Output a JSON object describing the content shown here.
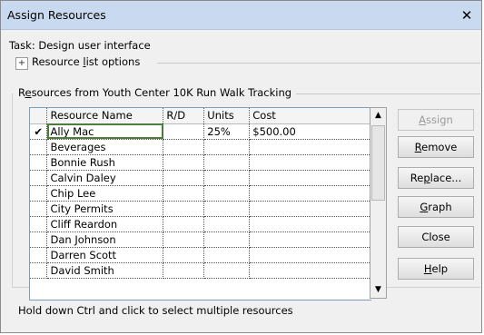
{
  "window": {
    "title": "Assign Resources",
    "close_glyph": "✕"
  },
  "task": {
    "text": "Task: Design user interface"
  },
  "options": {
    "expander_glyph": "+",
    "label_pre": "Resource ",
    "label_key": "l",
    "label_post": "ist options"
  },
  "group": {
    "label_pre": "R",
    "label_key": "e",
    "label_post": "sources from Youth Center 10K Run Walk Tracking"
  },
  "table": {
    "columns": [
      "",
      "Resource Name",
      "R/D",
      "Units",
      "Cost"
    ],
    "rows": [
      {
        "check": "✔",
        "name": "Ally Mac",
        "rd": "",
        "units": "25%",
        "cost": "$500.00"
      },
      {
        "check": "",
        "name": "Beverages",
        "rd": "",
        "units": "",
        "cost": ""
      },
      {
        "check": "",
        "name": "Bonnie Rush",
        "rd": "",
        "units": "",
        "cost": ""
      },
      {
        "check": "",
        "name": "Calvin Daley",
        "rd": "",
        "units": "",
        "cost": ""
      },
      {
        "check": "",
        "name": "Chip Lee",
        "rd": "",
        "units": "",
        "cost": ""
      },
      {
        "check": "",
        "name": "City Permits",
        "rd": "",
        "units": "",
        "cost": ""
      },
      {
        "check": "",
        "name": "Cliff Reardon",
        "rd": "",
        "units": "",
        "cost": ""
      },
      {
        "check": "",
        "name": "Dan Johnson",
        "rd": "",
        "units": "",
        "cost": ""
      },
      {
        "check": "",
        "name": "Darren Scott",
        "rd": "",
        "units": "",
        "cost": ""
      },
      {
        "check": "",
        "name": "David Smith",
        "rd": "",
        "units": "",
        "cost": ""
      }
    ]
  },
  "scrollbar": {
    "up_glyph": "▲",
    "down_glyph": "▼"
  },
  "buttons": {
    "assign": {
      "key": "A",
      "rest": "ssign"
    },
    "remove": {
      "key": "R",
      "rest": "emove"
    },
    "replace": {
      "pre": "Re",
      "key": "p",
      "rest": "lace..."
    },
    "graph": {
      "key": "G",
      "rest": "raph"
    },
    "close": {
      "label": "Close"
    },
    "help": {
      "key": "H",
      "rest": "elp"
    }
  },
  "hint": {
    "text": "Hold down Ctrl and click to select multiple resources"
  },
  "colors": {
    "titlebar": "#c9daf0",
    "dialog_bg": "#f0f0f0",
    "selection_border": "#4b7e3a"
  }
}
